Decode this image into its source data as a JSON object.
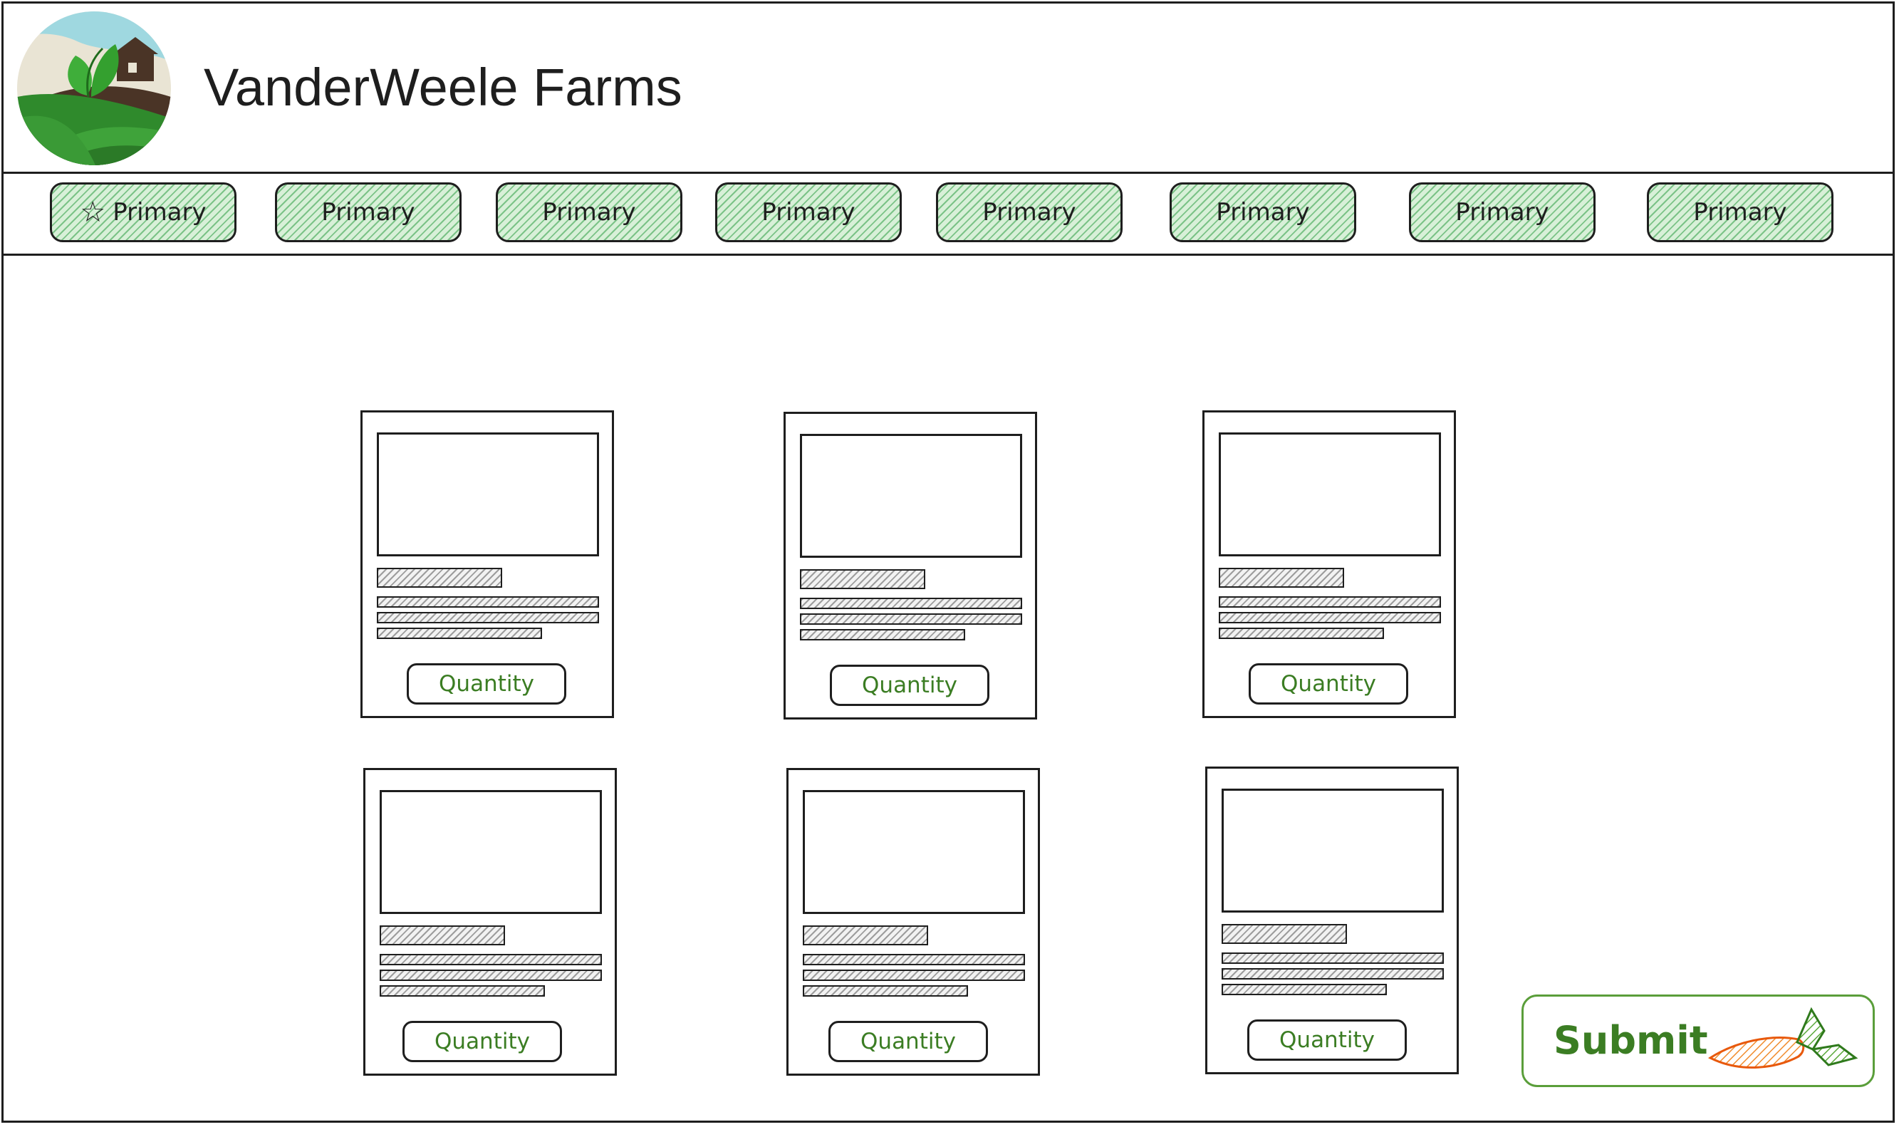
{
  "header": {
    "title": "VanderWeele Farms",
    "logo_icon": "farm-logo-icon"
  },
  "nav": {
    "items": [
      {
        "label": "Primary",
        "icon": "star-icon"
      },
      {
        "label": "Primary"
      },
      {
        "label": "Primary"
      },
      {
        "label": "Primary"
      },
      {
        "label": "Primary"
      },
      {
        "label": "Primary"
      },
      {
        "label": "Primary"
      },
      {
        "label": "Primary"
      }
    ]
  },
  "products": [
    {
      "button_label": "Quantity"
    },
    {
      "button_label": "Quantity"
    },
    {
      "button_label": "Quantity"
    },
    {
      "button_label": "Quantity"
    },
    {
      "button_label": "Quantity"
    },
    {
      "button_label": "Quantity"
    }
  ],
  "submit": {
    "label": "Submit",
    "icon": "carrot-icon"
  },
  "colors": {
    "nav_fill": "#d8f0d8",
    "accent_green": "#3b7d23",
    "carrot_orange": "#f08c2e"
  }
}
